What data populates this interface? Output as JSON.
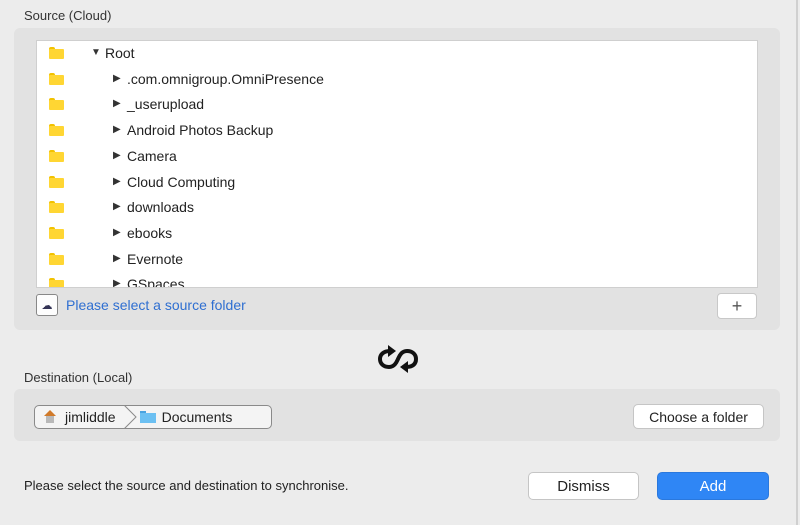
{
  "source": {
    "label": "Source (Cloud)",
    "tree": [
      {
        "label": "Root",
        "disclosure": "▼",
        "indent": 0
      },
      {
        "label": ".com.omnigroup.OmniPresence",
        "disclosure": "▶",
        "indent": 1
      },
      {
        "label": "_userupload",
        "disclosure": "▶",
        "indent": 1
      },
      {
        "label": "Android Photos Backup",
        "disclosure": "▶",
        "indent": 1
      },
      {
        "label": "Camera",
        "disclosure": "▶",
        "indent": 1
      },
      {
        "label": "Cloud Computing",
        "disclosure": "▶",
        "indent": 1
      },
      {
        "label": "downloads",
        "disclosure": "▶",
        "indent": 1
      },
      {
        "label": "ebooks",
        "disclosure": "▶",
        "indent": 1
      },
      {
        "label": "Evernote",
        "disclosure": "▶",
        "indent": 1
      },
      {
        "label": "GSpaces",
        "disclosure": "▶",
        "indent": 1
      }
    ],
    "status_text": "Please select a source folder",
    "add_button": "+"
  },
  "destination": {
    "label": "Destination (Local)",
    "path": [
      "jimliddle",
      "Documents"
    ],
    "choose_button": "Choose a folder"
  },
  "footer": {
    "message": "Please select the source and destination to synchronise.",
    "dismiss": "Dismiss",
    "add": "Add"
  },
  "colors": {
    "accent": "#2f86f5",
    "link": "#2f6fd1",
    "folder_yellow": "#ffd633",
    "folder_blue": "#6cc0f2"
  },
  "icons": {
    "tree_item": "folder-icon",
    "status": "cloud-drive-icon",
    "sync": "sync-icon",
    "home": "home-icon",
    "destination_folder": "folder-icon"
  }
}
